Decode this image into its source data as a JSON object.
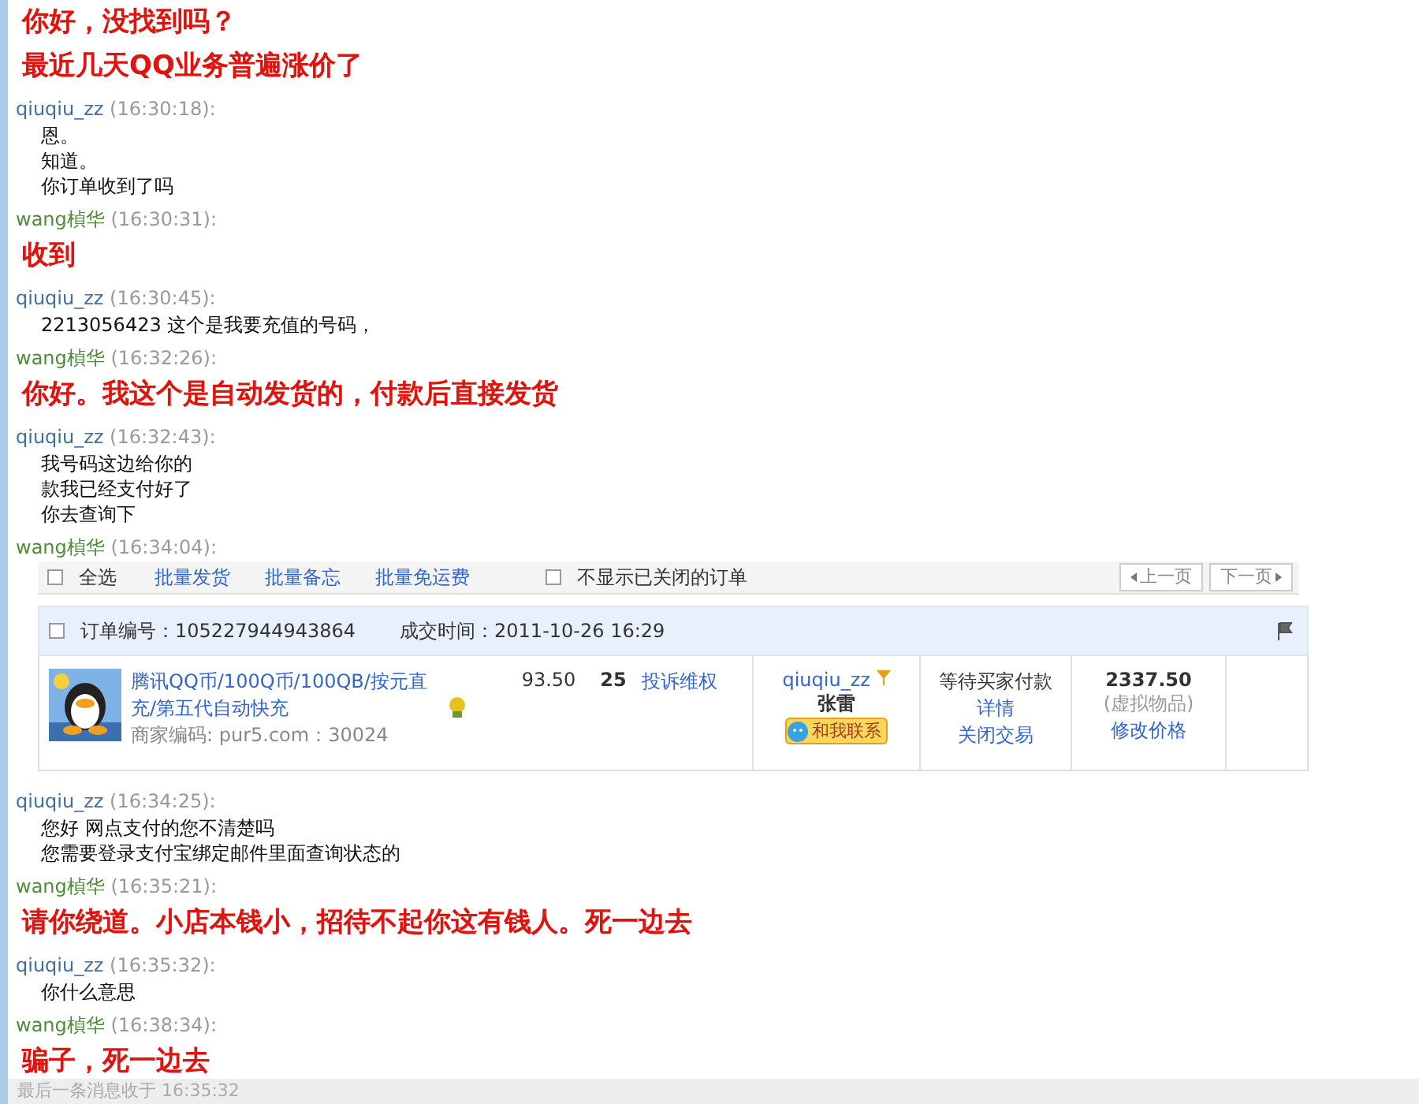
{
  "messages": [
    {
      "kind": "seller",
      "lines": [
        "你好，没找到吗？",
        "最近几天QQ业务普遍涨价了"
      ]
    },
    {
      "kind": "buyer",
      "sender": "qiuqiu_zz",
      "time": "(16:30:18):",
      "lines": [
        "恩。",
        "知道。",
        "你订单收到了吗"
      ]
    },
    {
      "kind": "seller",
      "sender": "wang楨华",
      "time": "(16:30:31):",
      "lines": [
        "收到"
      ]
    },
    {
      "kind": "buyer",
      "sender": "qiuqiu_zz",
      "time": "(16:30:45):",
      "lines": [
        "2213056423   这个是我要充值的号码，"
      ]
    },
    {
      "kind": "seller",
      "sender": "wang楨华",
      "time": "(16:32:26):",
      "lines": [
        "你好。我这个是自动发货的，付款后直接发货"
      ]
    },
    {
      "kind": "buyer",
      "sender": "qiuqiu_zz",
      "time": "(16:32:43):",
      "lines": [
        "我号码这边给你的",
        "款我已经支付好了",
        "你去查询下"
      ]
    },
    {
      "kind": "seller",
      "sender": "wang楨华",
      "time": "(16:34:04):",
      "order": {
        "toolbar": {
          "select_all": {
            "label": "全选",
            "checked": false
          },
          "actions": [
            "批量发货",
            "批量备忘",
            "批量免运费"
          ],
          "hide_closed": {
            "label": "不显示已关闭的订单",
            "checked": false
          },
          "pager": [
            "上一页",
            "下一页"
          ]
        },
        "header": {
          "checked": false,
          "order_no": "订单编号：105227944943864",
          "deal_time": "成交时间：2011-10-26 16:29"
        },
        "item": {
          "title": "腾讯QQ币/100Q币/100QB/按元直充/第五代自动快充",
          "merchant_code": "商家编码: pur5.com：30024",
          "price": "93.50",
          "quantity": "25",
          "complaint": "投诉维权",
          "buyer": "qiuqiu_zz",
          "buyer_name": "张雷",
          "contact": "和我联系",
          "status": "等待买家付款",
          "details": "详情",
          "close": "关闭交易",
          "total": "2337.50",
          "total_note": "(虚拟物品)",
          "modify": "修改价格"
        }
      }
    },
    {
      "kind": "buyer",
      "sender": "qiuqiu_zz",
      "time": "(16:34:25):",
      "lines": [
        "您好  网点支付的您不清楚吗",
        "您需要登录支付宝绑定邮件里面查询状态的"
      ]
    },
    {
      "kind": "seller",
      "sender": "wang楨华",
      "time": "(16:35:21):",
      "lines": [
        "请你绕道。小店本钱小，招待不起你这有钱人。死一边去"
      ]
    },
    {
      "kind": "buyer",
      "sender": "qiuqiu_zz",
      "time": "(16:35:32):",
      "lines": [
        "你什么意思"
      ]
    },
    {
      "kind": "seller",
      "sender": "wang楨华",
      "time": "(16:38:34):",
      "lines": [
        "骗子，死一边去"
      ]
    }
  ],
  "status_bar": "最后一条消息收于 16:35:32"
}
